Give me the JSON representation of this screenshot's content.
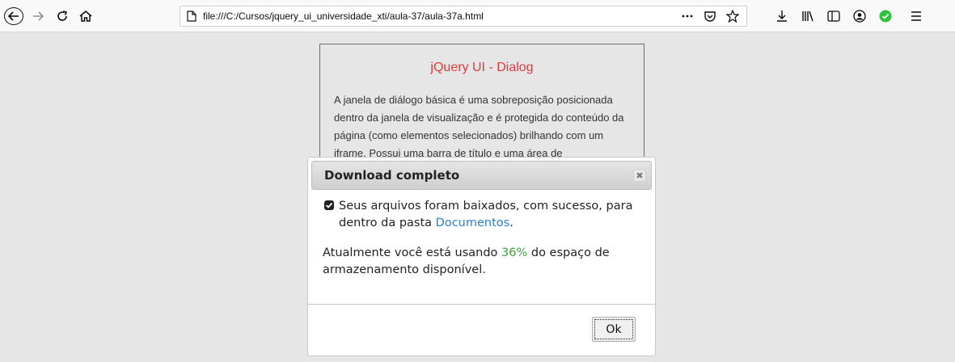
{
  "browser": {
    "url": "file:///C:/Cursos/jquery_ui_universidade_xti/aula-37/aula-37a.html",
    "icons": {
      "back": "back-arrow-icon",
      "forward": "forward-arrow-icon",
      "reload": "reload-icon",
      "home": "home-icon",
      "page": "page-icon",
      "more": "more-icon",
      "pocket": "pocket-icon",
      "bookmark": "star-icon",
      "downloads": "download-icon",
      "library": "library-icon",
      "sidebar": "sidebar-icon",
      "account": "account-icon",
      "extension": "green-check-icon",
      "menu": "hamburger-menu-icon"
    }
  },
  "page": {
    "title": "jQuery UI - Dialog",
    "body": "A janela de diálogo básica é uma sobreposição posicionada dentro da janela de visualização e é protegida do conteúdo da página (como elementos selecionados) brilhando com um iframe. Possui uma barra de título e uma área de"
  },
  "dialog": {
    "title": "Download completo",
    "close_label": "✖",
    "message_part1": "Seus arquivos foram baixados, com sucesso, para dentro da pasta ",
    "message_link": "Documentos",
    "message_end": ".",
    "usage_part1": "Atualmente você está usando ",
    "usage_percent": "36%",
    "usage_part2": " do espaço de armazenamento disponível.",
    "ok_label": "Ok"
  },
  "colors": {
    "page_title": "#e23b3b",
    "link": "#2a7fc9",
    "percent": "#3aa53a",
    "background": "#e6e6e6"
  }
}
